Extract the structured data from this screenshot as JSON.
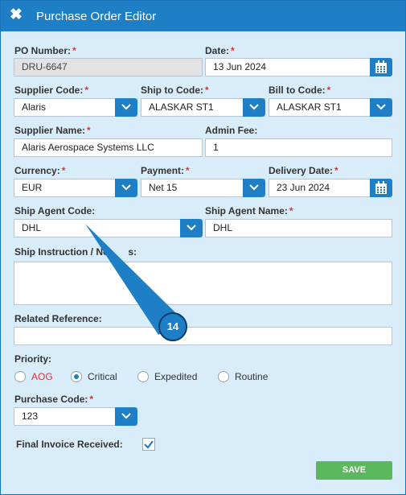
{
  "window": {
    "title": "Purchase Order Editor"
  },
  "fields": {
    "po_number": {
      "label": "PO Number:",
      "value": "DRU-6647"
    },
    "date": {
      "label": "Date:",
      "value": "13 Jun 2024"
    },
    "supplier_code": {
      "label": "Supplier Code:",
      "value": "Alaris"
    },
    "ship_to_code": {
      "label": "Ship to Code:",
      "value": "ALASKAR ST1"
    },
    "bill_to_code": {
      "label": "Bill to Code:",
      "value": "ALASKAR ST1"
    },
    "supplier_name": {
      "label": "Supplier Name:",
      "value": "Alaris Aerospace Systems LLC"
    },
    "admin_fee": {
      "label": "Admin Fee:",
      "value": "1"
    },
    "currency": {
      "label": "Currency:",
      "value": "EUR"
    },
    "payment": {
      "label": "Payment:",
      "value": "Net 15"
    },
    "delivery_date": {
      "label": "Delivery Date:",
      "value": "23 Jun 2024"
    },
    "ship_agent_code": {
      "label": "Ship Agent Code:",
      "value": "DHL"
    },
    "ship_agent_name": {
      "label": "Ship Agent Name:",
      "value": "DHL"
    },
    "ship_instruction": {
      "label_a": "Ship Instruction / No",
      "label_b": "s:",
      "value": ""
    },
    "related_reference": {
      "label": "Related Reference:",
      "value": ""
    },
    "priority": {
      "label": "Priority:",
      "options": [
        "AOG",
        "Critical",
        "Expedited",
        "Routine"
      ],
      "selected": "Critical"
    },
    "purchase_code": {
      "label": "Purchase Code:",
      "value": "123"
    },
    "final_invoice": {
      "label": "Final Invoice Received:",
      "checked": true
    }
  },
  "required_marker": "*",
  "buttons": {
    "save": "SAVE"
  },
  "callout": {
    "number": "14"
  },
  "colors": {
    "accent": "#1e7fc6",
    "required": "#e03030",
    "aog": "#e03030",
    "save": "#5cb85c",
    "panel": "#d9ecf9"
  },
  "icons": {
    "close": "close-icon",
    "calendar": "calendar-icon",
    "dropdown": "chevron-down-icon",
    "check": "check-icon"
  }
}
